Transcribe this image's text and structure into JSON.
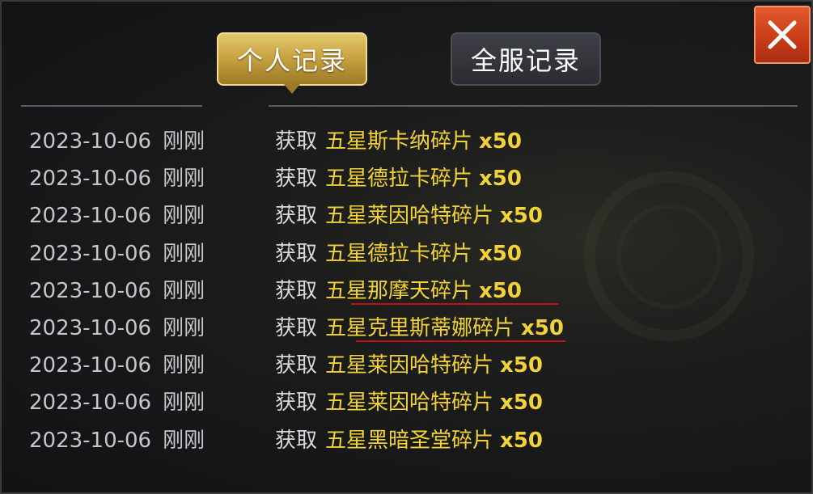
{
  "tabs": {
    "personal_label": "个人记录",
    "server_label": "全服记录",
    "active": "personal"
  },
  "close_button": {
    "icon": "close-icon",
    "color": "#c73b17"
  },
  "records": [
    {
      "date": "2023-10-06",
      "ago": "刚刚",
      "verb": "获取",
      "item": "五星斯卡纳碎片",
      "qty": "x50"
    },
    {
      "date": "2023-10-06",
      "ago": "刚刚",
      "verb": "获取",
      "item": "五星德拉卡碎片",
      "qty": "x50"
    },
    {
      "date": "2023-10-06",
      "ago": "刚刚",
      "verb": "获取",
      "item": "五星莱因哈特碎片",
      "qty": "x50"
    },
    {
      "date": "2023-10-06",
      "ago": "刚刚",
      "verb": "获取",
      "item": "五星德拉卡碎片",
      "qty": "x50"
    },
    {
      "date": "2023-10-06",
      "ago": "刚刚",
      "verb": "获取",
      "item": "五星那摩天碎片",
      "qty": "x50"
    },
    {
      "date": "2023-10-06",
      "ago": "刚刚",
      "verb": "获取",
      "item": "五星克里斯蒂娜碎片",
      "qty": "x50"
    },
    {
      "date": "2023-10-06",
      "ago": "刚刚",
      "verb": "获取",
      "item": "五星莱因哈特碎片",
      "qty": "x50"
    },
    {
      "date": "2023-10-06",
      "ago": "刚刚",
      "verb": "获取",
      "item": "五星莱因哈特碎片",
      "qty": "x50"
    },
    {
      "date": "2023-10-06",
      "ago": "刚刚",
      "verb": "获取",
      "item": "五星黑暗圣堂碎片",
      "qty": "x50"
    }
  ],
  "colors": {
    "item_text": "#f2d23a",
    "highlight_underline": "#c1121b",
    "tab_active": "#c9a443"
  }
}
